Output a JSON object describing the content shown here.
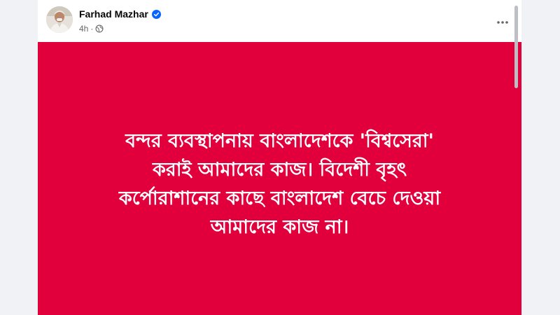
{
  "post": {
    "author": "Farhad Mazhar",
    "verified": true,
    "timestamp": "4h",
    "separator": "·",
    "audience_icon": "globe-icon",
    "more_icon": "more-options-icon",
    "background_color": "#e1003c",
    "text_color": "#ffffff",
    "text_lines": [
      "বন্দর ব্যবস্থাপনায় বাংলাদেশকে 'বিশ্বসেরা'",
      "করাই আমাদের কাজ। বিদেশী বৃহৎ",
      "কর্পোরাশানের কাছে বাংলাদেশ বেচে দেওয়া",
      "আমাদের কাজ না।"
    ]
  }
}
